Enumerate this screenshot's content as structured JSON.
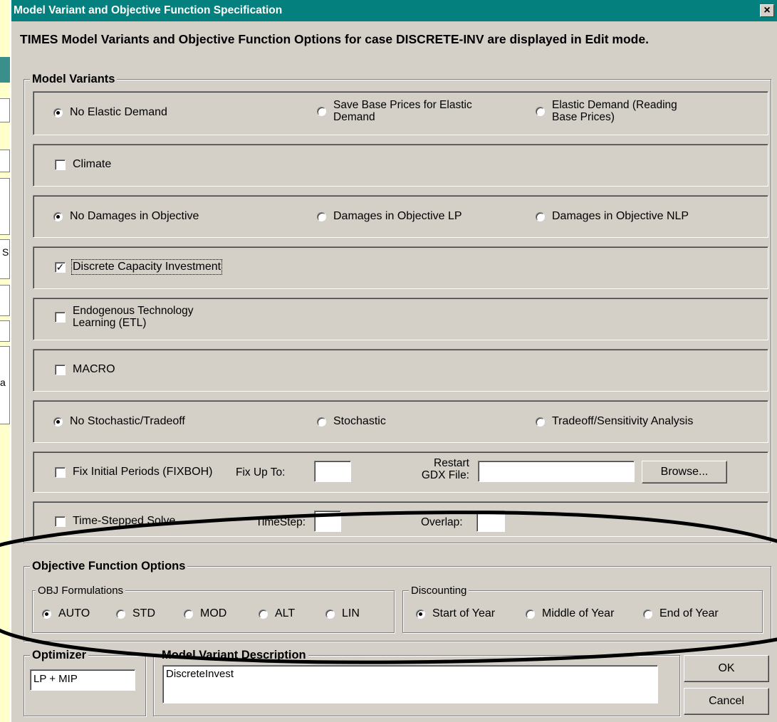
{
  "dialog": {
    "title": "Model Variant and Objective Function Specification",
    "close_glyph": "×",
    "header": "TIMES Model Variants and Objective Function Options for case DISCRETE-INV are displayed in Edit mode."
  },
  "model_variants": {
    "legend": "Model Variants",
    "elastic": {
      "opt1": "No Elastic Demand",
      "opt2_line1": "Save Base Prices for Elastic",
      "opt2_line2": "Demand",
      "opt3_line1": "Elastic Demand (Reading",
      "opt3_line2": "Base Prices)",
      "selected": 1
    },
    "climate": {
      "label": "Climate",
      "checked": false
    },
    "damages": {
      "opt1": "No Damages in Objective",
      "opt2": "Damages in Objective LP",
      "opt3": "Damages in Objective NLP",
      "selected": 1
    },
    "discrete": {
      "label": "Discrete Capacity Investment",
      "checked": true,
      "check_glyph": "✓"
    },
    "etl": {
      "line1": "Endogenous Technology",
      "line2": "Learning (ETL)",
      "checked": false
    },
    "macro": {
      "label": "MACRO",
      "checked": false
    },
    "stochastic": {
      "opt1": "No Stochastic/Tradeoff",
      "opt2": "Stochastic",
      "opt3": "Tradeoff/Sensitivity Analysis",
      "selected": 1
    },
    "fixboh": {
      "label": "Fix Initial Periods (FIXBOH)",
      "fix_up_to_label": "Fix Up To:",
      "fix_up_to_value": "",
      "restart_label_line1": "Restart",
      "restart_label_line2": "GDX File:",
      "restart_value": "",
      "browse_label": "Browse..."
    },
    "timestepped": {
      "label": "Time-Stepped Solve",
      "timestep_label": "TimeStep:",
      "timestep_value": "",
      "overlap_label": "Overlap:",
      "overlap_value": ""
    }
  },
  "objective": {
    "legend": "Objective Function Options",
    "formulations": {
      "legend": "OBJ Formulations",
      "options": [
        "AUTO",
        "STD",
        "MOD",
        "ALT",
        "LIN"
      ],
      "selected": "AUTO"
    },
    "discounting": {
      "legend": "Discounting",
      "options": [
        "Start of Year",
        "Middle of Year",
        "End of Year"
      ],
      "selected": "Start of Year"
    }
  },
  "optimizer": {
    "legend": "Optimizer",
    "value": "LP + MIP"
  },
  "description": {
    "legend": "Model Variant Description",
    "value": "DiscreteInvest"
  },
  "buttons": {
    "ok": "OK",
    "cancel": "Cancel"
  },
  "background_fragments": {
    "text1": "S",
    "text2": "a"
  }
}
